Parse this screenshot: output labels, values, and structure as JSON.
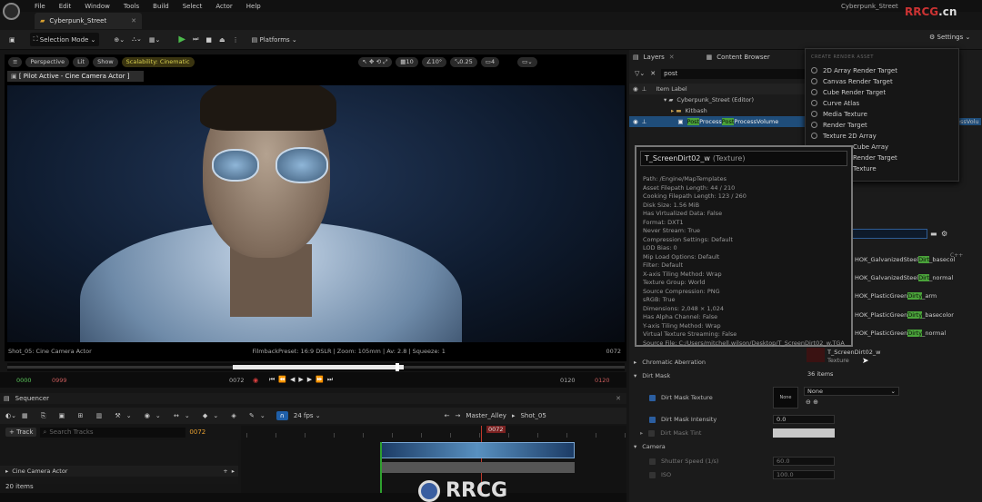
{
  "menu": [
    "File",
    "Edit",
    "Window",
    "Tools",
    "Build",
    "Select",
    "Actor",
    "Help"
  ],
  "tab": {
    "title": "Cyberpunk_Street"
  },
  "project": {
    "name": "Cyberpunk_Street"
  },
  "watermark": {
    "top": "RRCG.cn",
    "bottom": "RRCG"
  },
  "toolbar": {
    "selection_mode": "Selection Mode",
    "platforms": "Platforms",
    "settings": "Settings"
  },
  "viewport": {
    "perspective": "Perspective",
    "lit": "Lit",
    "show": "Show",
    "scalability": "Scalability: Cinematic",
    "pilot": "[ Pilot Active - Cine Camera Actor ]",
    "grid": "10",
    "angle": "10°",
    "scale": "0.25",
    "cam": "4"
  },
  "viewinfo": {
    "left": "Shot_05: Cine Camera Actor",
    "center": "FilmbackPreset: 16:9 DSLR | Zoom: 105mm | Av: 2.8 | Squeeze: 1",
    "right": "0072"
  },
  "transport": {
    "start": "0000",
    "start2": "0999",
    "current": "0072",
    "end": "0120",
    "end2": "0120"
  },
  "sequencer": {
    "title": "Sequencer",
    "fps": "24 fps",
    "master": "Master_Alley",
    "shot": "Shot_05"
  },
  "tracks": {
    "add": "Track",
    "search_placeholder": "Search Tracks",
    "frame": "0072",
    "cine": "Cine Camera Actor",
    "items": "20 items"
  },
  "outliner": {
    "tab_layers": "Layers",
    "tab_content": "Content Browser",
    "search": "post",
    "col_label": "Item Label",
    "rows": [
      "Cyberpunk_Street (Editor)",
      "Kitbash"
    ],
    "sel_pre": "Post",
    "sel_mid": "Process",
    "sel_hl2": "Post",
    "sel_rest": "ProcessVolume",
    "sel_right": "essVolu"
  },
  "menu_create": {
    "header": "CREATE RENDER ASSET",
    "items": [
      "2D Array Render Target",
      "Canvas Render Target",
      "Cube Render Target",
      "Curve Atlas",
      "Media Texture",
      "Render Target",
      "Texture 2D Array",
      "Cube Array",
      "Render Target",
      "Texture"
    ]
  },
  "tooltip": {
    "title": "T_ScreenDirt02_w",
    "type": "(Texture)",
    "lines": [
      "Path: /Engine/MapTemplates",
      "Asset Filepath Length: 44 / 210",
      "Cooking Filepath Length: 123 / 260",
      "Disk Size: 1.56 MiB",
      "Has Virtualized Data: False",
      "Format: DXT1",
      "Never Stream: True",
      "Compression Settings: Default",
      "LOD Bias: 0",
      "Mip Load Options: Default",
      "Filter: Default",
      "X-axis Tiling Method: Wrap",
      "Texture Group: World",
      "Source Compression: PNG",
      "sRGB: True",
      "Dimensions: 2,048 × 1,024",
      "Has Alpha Channel: False",
      "Y-axis Tiling Method: Wrap",
      "Virtual Texture Streaming: False",
      "Source File: C:/Users/mitchell.wilson/Desktop/T_ScreenDirt02_w.TGA"
    ]
  },
  "assets": {
    "rows": [
      {
        "pre": "HOK_GalvanizedSteel",
        "hl": "Dirt",
        "post": "_basecol"
      },
      {
        "pre": "HOK_GalvanizedSteel",
        "hl": "Dirt",
        "post": "_normal"
      },
      {
        "pre": "HOK_PlasticGreen",
        "hl": "Dirty",
        "post": "_arm"
      },
      {
        "pre": "HOK_PlasticGreen",
        "hl": "Dirty",
        "post": "_basecolor"
      },
      {
        "pre": "HOK_PlasticGreen",
        "hl": "Dirty",
        "post": "_normal"
      }
    ],
    "sel_name": "T_ScreenDirt02_w",
    "sel_type": "Texture",
    "count": "36 items",
    "cpp": "C++"
  },
  "details": {
    "chromatic": "Chromatic Aberration",
    "dirt_mask": "Dirt Mask",
    "dm_texture": "Dirt Mask Texture",
    "dm_none": "None",
    "dm_intensity": "Dirt Mask Intensity",
    "dm_intensity_val": "0.0",
    "dm_tint": "Dirt Mask Tint",
    "camera": "Camera",
    "shutter": "Shutter Speed (1/s)",
    "shutter_val": "60.0",
    "iso": "ISO",
    "iso_val": "100.0",
    "none": "None"
  }
}
